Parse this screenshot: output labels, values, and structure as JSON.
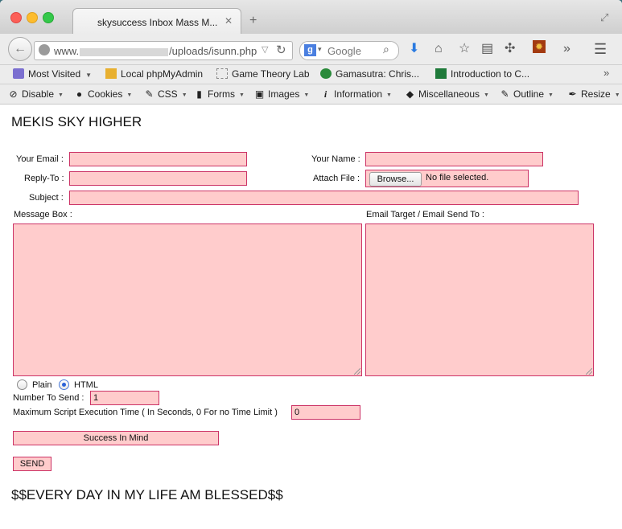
{
  "browser": {
    "tab_title": "skysuccess Inbox Mass M...",
    "url_prefix": "www.",
    "url_path": "/uploads/isunn.php",
    "search_engine": "Google",
    "search_placeholder": "Google"
  },
  "bookmarks": [
    {
      "label": "Most Visited"
    },
    {
      "label": "Local phpMyAdmin"
    },
    {
      "label": "Game Theory Lab"
    },
    {
      "label": "Gamasutra: Chris..."
    },
    {
      "label": "Introduction to C..."
    }
  ],
  "devtools": [
    {
      "label": "Disable"
    },
    {
      "label": "Cookies"
    },
    {
      "label": "CSS"
    },
    {
      "label": "Forms"
    },
    {
      "label": "Images"
    },
    {
      "label": "Information"
    },
    {
      "label": "Miscellaneous"
    },
    {
      "label": "Outline"
    },
    {
      "label": "Resize"
    }
  ],
  "page": {
    "heading": "MEKIS SKY HIGHER",
    "your_email_label": "Your Email :",
    "your_name_label": "Your Name :",
    "reply_to_label": "Reply-To :",
    "attach_file_label": "Attach File :",
    "browse_label": "Browse...",
    "no_file_text": "No file selected.",
    "subject_label": "Subject :",
    "message_box_label": "Message Box :",
    "email_target_label": "Email Target / Email Send To :",
    "radio_plain_label": "Plain",
    "radio_html_label": "HTML",
    "selected_format": "HTML",
    "number_to_send_label": "Number To Send :",
    "number_to_send_value": "1",
    "max_time_label": "Maximum Script Execution Time ( In Seconds, 0 For no Time Limit )",
    "max_time_value": "0",
    "success_text": "Success In Mind",
    "send_label": "SEND",
    "footer": "$$EVERY DAY IN MY LIFE AM BLESSED$$"
  },
  "colors": {
    "field_bg": "#ffcccc",
    "field_border": "#cc3366"
  }
}
